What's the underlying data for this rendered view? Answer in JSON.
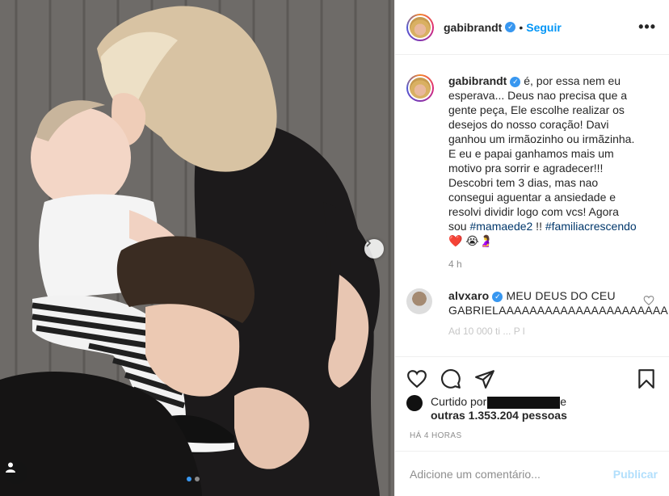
{
  "media": {
    "carousel_index": 1,
    "carousel_total": 2
  },
  "header": {
    "username": "gabibrandt",
    "separator": "•",
    "follow_label": "Seguir",
    "more_icon": "more-horizontal-icon"
  },
  "caption": {
    "username": "gabibrandt",
    "text_before": " é, por essa nem eu esperava... Deus nao precisa que a gente peça, Ele escolhe realizar os desejos do nosso coração! Davi ganhou um irmãozinho ou irmãzinha. E eu e papai ganhamos mais um motivo pra sorrir e agradecer!!! Descobri tem 3 dias, mas nao consegui aguentar a ansiedade e resolvi dividir logo com vcs! Agora sou ",
    "tag1": "#mamaede2",
    "middle": " !! ",
    "tag2": "#familiacrescendo",
    "emojis": " ❤️ 😭🤰",
    "time": "4 h"
  },
  "comment": {
    "username": "alvxaro",
    "text": " MEU DEUS DO CEU GABRIELAAAAAAAAAAAAAAAAAAAAAA",
    "faded_text": "Ad  10 000  ti  ... P    l"
  },
  "likes": {
    "prefix": "Curtido por",
    "suffix": "e",
    "others": "outras 1.353.204 pessoas"
  },
  "posted": "HÁ 4 HORAS",
  "add_comment": {
    "placeholder": "Adicione um comentário...",
    "publish_label": "Publicar"
  },
  "colors": {
    "accent": "#0095f6",
    "publish_disabled": "#b2dffc",
    "verified": "#3897f0",
    "heart": "#ed4956"
  }
}
